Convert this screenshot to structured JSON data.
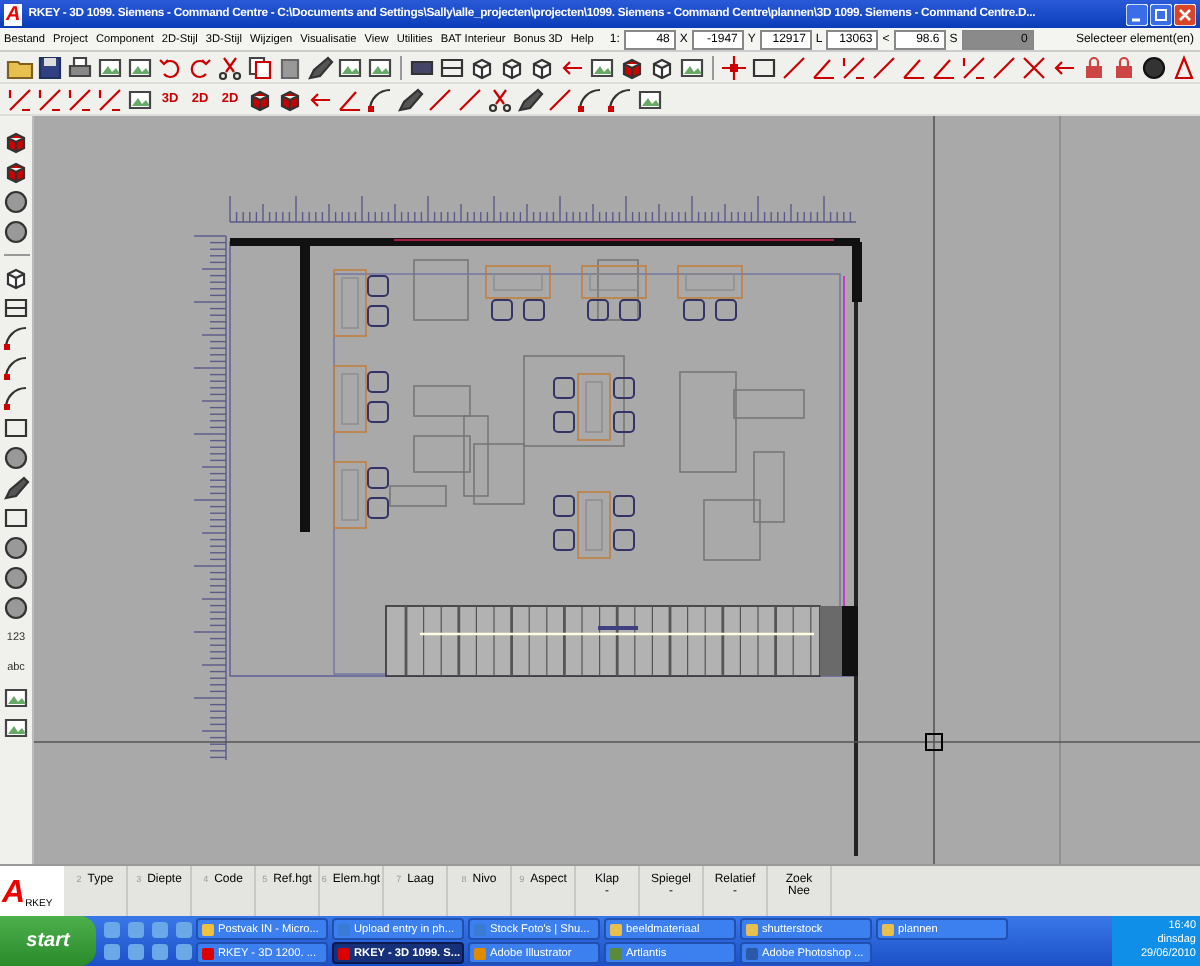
{
  "window": {
    "logo": "A",
    "title": "RKEY - 3D 1099. Siemens - Command Centre - C:\\Documents and Settings\\Sally\\alle_projecten\\projecten\\1099. Siemens - Command Centre\\plannen\\3D 1099. Siemens - Command Centre.D..."
  },
  "menu": [
    "Bestand",
    "Project",
    "Component",
    "2D-Stijl",
    "3D-Stijl",
    "Wijzigen",
    "Visualisatie",
    "View",
    "Utilities",
    "BAT Interieur",
    "Bonus 3D",
    "Help"
  ],
  "coordinates": [
    {
      "label": "1:",
      "value": "48",
      "kind": "plain"
    },
    {
      "label": "X",
      "value": "-1947",
      "kind": "plain"
    },
    {
      "label": "Y",
      "value": "12917",
      "kind": "plain"
    },
    {
      "label": "L",
      "value": "13063",
      "kind": "plain"
    },
    {
      "label": "<",
      "value": "98.6",
      "kind": "plain"
    },
    {
      "label": "S",
      "value": "0",
      "kind": "dark"
    }
  ],
  "prompt": "Selecteer element(en)",
  "toolbar_2_labels": [
    "3D",
    "2D",
    "2D"
  ],
  "left_toolbar_labels": [
    "123",
    "abc"
  ],
  "parameter_bar": {
    "logo_mark": "A",
    "logo_text": "RKEY",
    "fields": [
      {
        "index": "2",
        "label": "Type"
      },
      {
        "index": "3",
        "label": "Diepte"
      },
      {
        "index": "4",
        "label": "Code"
      },
      {
        "index": "5",
        "label": "Ref.hgt"
      },
      {
        "index": "6",
        "label": "Elem.hgt"
      },
      {
        "index": "7",
        "label": "Laag"
      },
      {
        "index": "8",
        "label": "Nivo"
      },
      {
        "index": "9",
        "label": "Aspect"
      },
      {
        "label": "Klap",
        "value": "-"
      },
      {
        "label": "Spiegel",
        "value": "-"
      },
      {
        "label": "Relatief",
        "value": "-"
      },
      {
        "label": "Zoek",
        "value": "Nee"
      }
    ]
  },
  "taskbar": {
    "start": "start",
    "tasks": [
      {
        "label": "Postvak IN - Micro...",
        "kind": "mail",
        "selected": false
      },
      {
        "label": "Upload entry in ph...",
        "kind": "browser",
        "selected": false
      },
      {
        "label": "Stock Foto's | Shu...",
        "kind": "browser",
        "selected": false
      },
      {
        "label": "beeldmateriaal",
        "kind": "folder",
        "selected": false
      },
      {
        "label": "shutterstock",
        "kind": "folder",
        "selected": false
      },
      {
        "label": "plannen",
        "kind": "folder",
        "selected": false
      },
      {
        "label": "RKEY - 3D 1200. ...",
        "kind": "arkey",
        "selected": false
      },
      {
        "label": "RKEY - 3D 1099. S...",
        "kind": "arkey",
        "selected": true
      },
      {
        "label": "Adobe Illustrator",
        "kind": "illustrator",
        "selected": false
      },
      {
        "label": "Artlantis",
        "kind": "artlantis",
        "selected": false
      },
      {
        "label": "Adobe Photoshop ...",
        "kind": "photoshop",
        "selected": false
      }
    ],
    "clock": {
      "time": "16:40",
      "day": "dinsdag",
      "date": "29/06/2010"
    }
  }
}
